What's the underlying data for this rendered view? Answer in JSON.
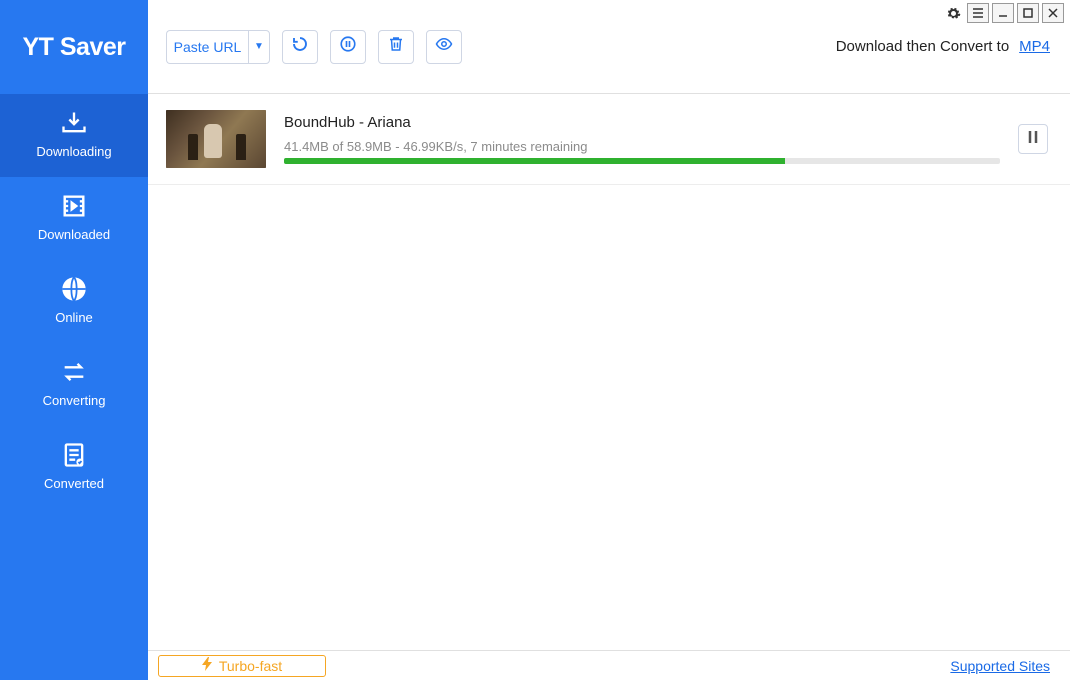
{
  "brand": "YT Saver",
  "sidebar": {
    "items": [
      {
        "label": "Downloading",
        "icon": "download-tray-icon",
        "active": true
      },
      {
        "label": "Downloaded",
        "icon": "film-check-icon",
        "active": false
      },
      {
        "label": "Online",
        "icon": "globe-icon",
        "active": false
      },
      {
        "label": "Converting",
        "icon": "transfer-arrows-icon",
        "active": false
      },
      {
        "label": "Converted",
        "icon": "document-check-icon",
        "active": false
      }
    ]
  },
  "toolbar": {
    "paste_label": "Paste URL",
    "caret": "▼",
    "convert_label": "Download then Convert to",
    "convert_format": "MP4"
  },
  "downloads": [
    {
      "title": "BoundHub - Ariana",
      "stats": "41.4MB of 58.9MB -   46.99KB/s, 7 minutes remaining",
      "progress_percent": 70
    }
  ],
  "footer": {
    "turbo_label": "Turbo-fast",
    "supported_label": "Supported Sites"
  },
  "colors": {
    "primary": "#2778f0",
    "primary_dark": "#1d62d4",
    "progress": "#2fb12f",
    "accent_orange": "#f5a623",
    "link": "#1a6ae6"
  }
}
